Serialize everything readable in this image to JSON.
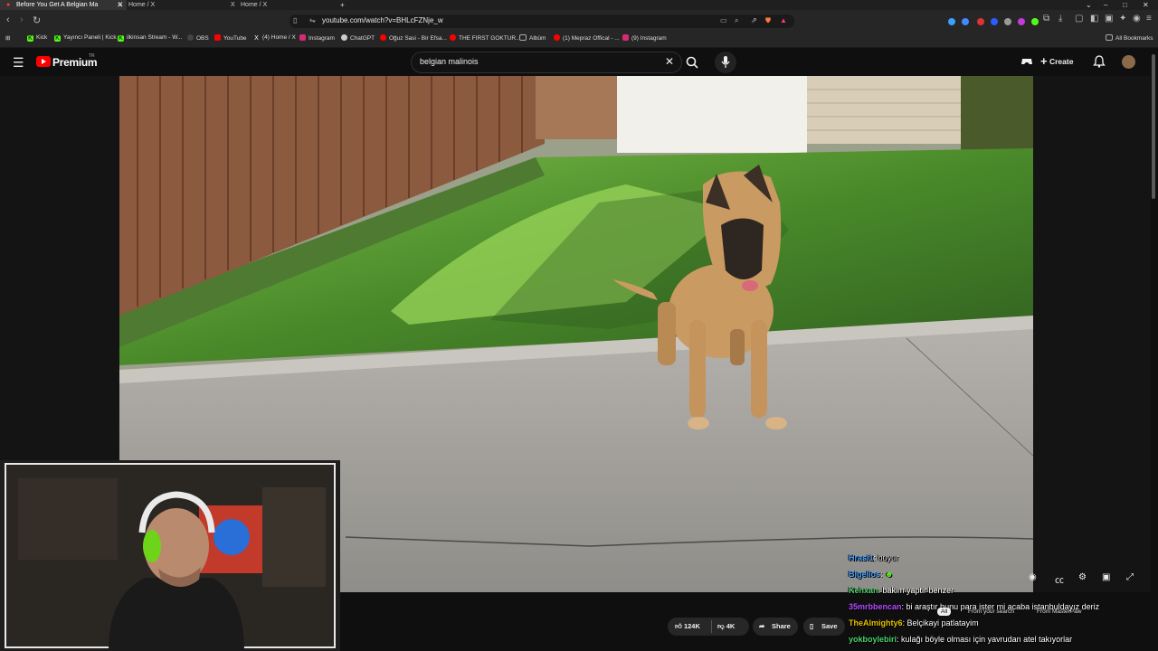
{
  "browser": {
    "tabs": [
      {
        "title": "Before You Get A Belgian Ma",
        "active": true
      },
      {
        "title": "Home / X",
        "active": false
      },
      {
        "title": "Home / X",
        "active": false
      }
    ],
    "new_tab": "+",
    "url": "youtube.com/watch?v=BHLcFZNje_w",
    "bookmarks": [
      {
        "label": "Kick",
        "color": "#53fc18"
      },
      {
        "label": "Yayıncı Paneli | Kick",
        "color": "#53fc18"
      },
      {
        "label": "ilkinsan Stream - W...",
        "color": "#53fc18"
      },
      {
        "label": "OBS",
        "color": "#444444"
      },
      {
        "label": "YouTube",
        "color": "#ff0000"
      },
      {
        "label": "(4) Home / X",
        "color": "#000000"
      },
      {
        "label": "Instagram",
        "color": "#d62976"
      },
      {
        "label": "ChatGPT",
        "color": "#cccccc"
      },
      {
        "label": "Oğuz Sasi - Bir Efsa...",
        "color": "#ff0000"
      },
      {
        "label": "THE FIRST GOKTUR...",
        "color": "#ff0000"
      },
      {
        "label": "Albüm",
        "color": "#666666"
      },
      {
        "label": "(1) Mepraz Offical - ...",
        "color": "#ff0000"
      },
      {
        "label": "(9) Instagram",
        "color": "#d62976"
      }
    ],
    "all_bookmarks": "All Bookmarks"
  },
  "youtube": {
    "brand": "Premium",
    "region": "TR",
    "search_value": "belgian malinois",
    "create_label": "Create"
  },
  "actions": {
    "likes": "124K",
    "dislikes": "4K",
    "share": "Share",
    "save": "Save"
  },
  "chat": [
    {
      "user": "Kehxan",
      "color": "#4dd26b",
      "message": "bakim yaptir benzer"
    },
    {
      "user": "35mrbbencan",
      "color": "#b44dff",
      "message": "bi araştır bunu para ister mi acaba istanbuldayız deriz"
    },
    {
      "user": "TheAlmighty6",
      "color": "#e6c300",
      "message": "Belçikayi patlatayim"
    },
    {
      "user": "yokboylebiri",
      "color": "#4dd26b",
      "message": "kulağı böyle olması için yavrudan atel takıyorlar"
    }
  ],
  "chat_partial": [
    {
      "user": "Hrasi1",
      "message": "buyur",
      "user_color": "#4aa3ff"
    },
    {
      "user": "Bigellos",
      "message": "",
      "user_color": "#4aa3ff"
    }
  ],
  "recommendation_chips": [
    "All",
    "From your search",
    "From MasterPaw"
  ]
}
